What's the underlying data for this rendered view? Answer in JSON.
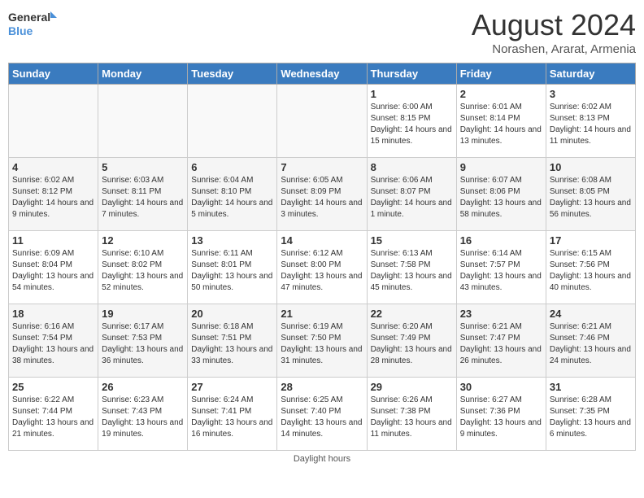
{
  "logo": {
    "line1": "General",
    "line2": "Blue"
  },
  "title": "August 2024",
  "subtitle": "Norashen, Ararat, Armenia",
  "days_header": [
    "Sunday",
    "Monday",
    "Tuesday",
    "Wednesday",
    "Thursday",
    "Friday",
    "Saturday"
  ],
  "footer": "Daylight hours",
  "weeks": [
    [
      {
        "day": "",
        "info": ""
      },
      {
        "day": "",
        "info": ""
      },
      {
        "day": "",
        "info": ""
      },
      {
        "day": "",
        "info": ""
      },
      {
        "day": "1",
        "info": "Sunrise: 6:00 AM\nSunset: 8:15 PM\nDaylight: 14 hours\nand 15 minutes."
      },
      {
        "day": "2",
        "info": "Sunrise: 6:01 AM\nSunset: 8:14 PM\nDaylight: 14 hours\nand 13 minutes."
      },
      {
        "day": "3",
        "info": "Sunrise: 6:02 AM\nSunset: 8:13 PM\nDaylight: 14 hours\nand 11 minutes."
      }
    ],
    [
      {
        "day": "4",
        "info": "Sunrise: 6:02 AM\nSunset: 8:12 PM\nDaylight: 14 hours\nand 9 minutes."
      },
      {
        "day": "5",
        "info": "Sunrise: 6:03 AM\nSunset: 8:11 PM\nDaylight: 14 hours\nand 7 minutes."
      },
      {
        "day": "6",
        "info": "Sunrise: 6:04 AM\nSunset: 8:10 PM\nDaylight: 14 hours\nand 5 minutes."
      },
      {
        "day": "7",
        "info": "Sunrise: 6:05 AM\nSunset: 8:09 PM\nDaylight: 14 hours\nand 3 minutes."
      },
      {
        "day": "8",
        "info": "Sunrise: 6:06 AM\nSunset: 8:07 PM\nDaylight: 14 hours\nand 1 minute."
      },
      {
        "day": "9",
        "info": "Sunrise: 6:07 AM\nSunset: 8:06 PM\nDaylight: 13 hours\nand 58 minutes."
      },
      {
        "day": "10",
        "info": "Sunrise: 6:08 AM\nSunset: 8:05 PM\nDaylight: 13 hours\nand 56 minutes."
      }
    ],
    [
      {
        "day": "11",
        "info": "Sunrise: 6:09 AM\nSunset: 8:04 PM\nDaylight: 13 hours\nand 54 minutes."
      },
      {
        "day": "12",
        "info": "Sunrise: 6:10 AM\nSunset: 8:02 PM\nDaylight: 13 hours\nand 52 minutes."
      },
      {
        "day": "13",
        "info": "Sunrise: 6:11 AM\nSunset: 8:01 PM\nDaylight: 13 hours\nand 50 minutes."
      },
      {
        "day": "14",
        "info": "Sunrise: 6:12 AM\nSunset: 8:00 PM\nDaylight: 13 hours\nand 47 minutes."
      },
      {
        "day": "15",
        "info": "Sunrise: 6:13 AM\nSunset: 7:58 PM\nDaylight: 13 hours\nand 45 minutes."
      },
      {
        "day": "16",
        "info": "Sunrise: 6:14 AM\nSunset: 7:57 PM\nDaylight: 13 hours\nand 43 minutes."
      },
      {
        "day": "17",
        "info": "Sunrise: 6:15 AM\nSunset: 7:56 PM\nDaylight: 13 hours\nand 40 minutes."
      }
    ],
    [
      {
        "day": "18",
        "info": "Sunrise: 6:16 AM\nSunset: 7:54 PM\nDaylight: 13 hours\nand 38 minutes."
      },
      {
        "day": "19",
        "info": "Sunrise: 6:17 AM\nSunset: 7:53 PM\nDaylight: 13 hours\nand 36 minutes."
      },
      {
        "day": "20",
        "info": "Sunrise: 6:18 AM\nSunset: 7:51 PM\nDaylight: 13 hours\nand 33 minutes."
      },
      {
        "day": "21",
        "info": "Sunrise: 6:19 AM\nSunset: 7:50 PM\nDaylight: 13 hours\nand 31 minutes."
      },
      {
        "day": "22",
        "info": "Sunrise: 6:20 AM\nSunset: 7:49 PM\nDaylight: 13 hours\nand 28 minutes."
      },
      {
        "day": "23",
        "info": "Sunrise: 6:21 AM\nSunset: 7:47 PM\nDaylight: 13 hours\nand 26 minutes."
      },
      {
        "day": "24",
        "info": "Sunrise: 6:21 AM\nSunset: 7:46 PM\nDaylight: 13 hours\nand 24 minutes."
      }
    ],
    [
      {
        "day": "25",
        "info": "Sunrise: 6:22 AM\nSunset: 7:44 PM\nDaylight: 13 hours\nand 21 minutes."
      },
      {
        "day": "26",
        "info": "Sunrise: 6:23 AM\nSunset: 7:43 PM\nDaylight: 13 hours\nand 19 minutes."
      },
      {
        "day": "27",
        "info": "Sunrise: 6:24 AM\nSunset: 7:41 PM\nDaylight: 13 hours\nand 16 minutes."
      },
      {
        "day": "28",
        "info": "Sunrise: 6:25 AM\nSunset: 7:40 PM\nDaylight: 13 hours\nand 14 minutes."
      },
      {
        "day": "29",
        "info": "Sunrise: 6:26 AM\nSunset: 7:38 PM\nDaylight: 13 hours\nand 11 minutes."
      },
      {
        "day": "30",
        "info": "Sunrise: 6:27 AM\nSunset: 7:36 PM\nDaylight: 13 hours\nand 9 minutes."
      },
      {
        "day": "31",
        "info": "Sunrise: 6:28 AM\nSunset: 7:35 PM\nDaylight: 13 hours\nand 6 minutes."
      }
    ]
  ]
}
